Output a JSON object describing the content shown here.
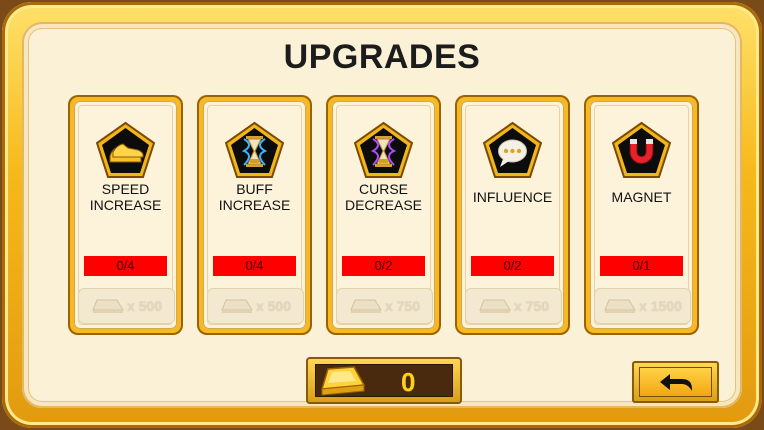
{
  "screen": {
    "title": "UPGRADES"
  },
  "upgrades": [
    {
      "name_line1": "SPEED",
      "name_line2": "INCREASE",
      "level": "0/4",
      "price": "x 500",
      "icon": "golden-shoes-icon"
    },
    {
      "name_line1": "BUFF",
      "name_line2": "INCREASE",
      "level": "0/4",
      "price": "x 500",
      "icon": "hourglass-blue-icon"
    },
    {
      "name_line1": "CURSE",
      "name_line2": "DECREASE",
      "level": "0/2",
      "price": "x 750",
      "icon": "hourglass-purple-icon"
    },
    {
      "name_line1": "INFLUENCE",
      "name_line2": "",
      "level": "0/2",
      "price": "x 750",
      "icon": "speech-bubble-icon"
    },
    {
      "name_line1": "MAGNET",
      "name_line2": "",
      "level": "0/1",
      "price": "x 1500",
      "icon": "magnet-icon"
    }
  ],
  "currency": {
    "gold": "0",
    "icon": "gold-bar-icon"
  },
  "navigation": {
    "back_icon": "back-arrow-icon"
  },
  "colors": {
    "frame": "#f6b923",
    "panel": "#fbf1d6",
    "level_bar": "#fe0000",
    "gold_text": "#ffd21a"
  }
}
